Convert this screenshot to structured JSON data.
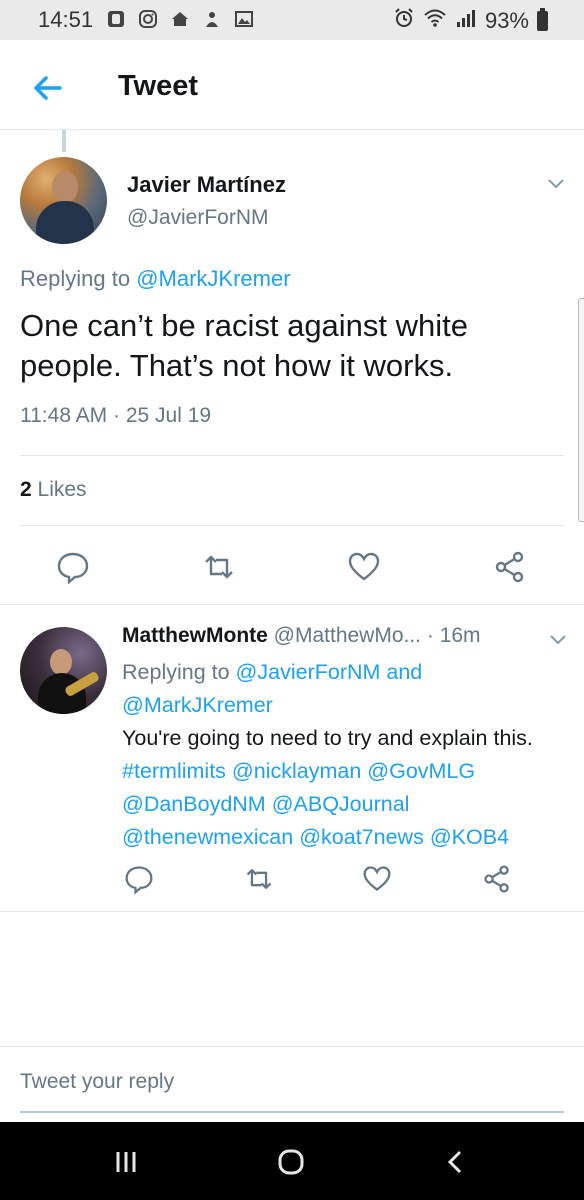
{
  "status_bar": {
    "time": "14:51",
    "battery": "93%",
    "icons": [
      "notification-icon",
      "instagram-icon",
      "home-icon",
      "download-icon",
      "gallery-icon",
      "alarm-icon",
      "wifi-icon",
      "signal-icon",
      "battery-icon"
    ]
  },
  "header": {
    "title": "Tweet"
  },
  "tweet": {
    "author_name": "Javier Martínez",
    "author_handle": "@JavierForNM",
    "replying_prefix": "Replying to ",
    "replying_handle": "@MarkJKremer",
    "text": "One can’t be racist against white people. That’s not how it works.",
    "timestamp": "11:48 AM · 25 Jul 19",
    "likes_count": "2",
    "likes_label": " Likes"
  },
  "reply": {
    "author_name": "MatthewMonte",
    "author_handle": " @MatthewMo...",
    "time": " · 16m",
    "replying_prefix": "Replying to ",
    "replying_handle1": "@JavierForNM",
    "replying_and": " and",
    "replying_handle2": "@MarkJKremer",
    "text_start": "You're going to need to try and explain this. ",
    "hashtag": "#termlimits",
    "mentions": [
      "@nicklayman",
      "@GovMLG",
      "@DanBoydNM",
      "@ABQJournal",
      "@thenewmexican",
      "@koat7news",
      "@KOB4"
    ]
  },
  "compose": {
    "placeholder": "Tweet your reply"
  },
  "colors": {
    "link": "#1da1f2",
    "secondary": "#657786",
    "divider": "#e1e8ed"
  }
}
